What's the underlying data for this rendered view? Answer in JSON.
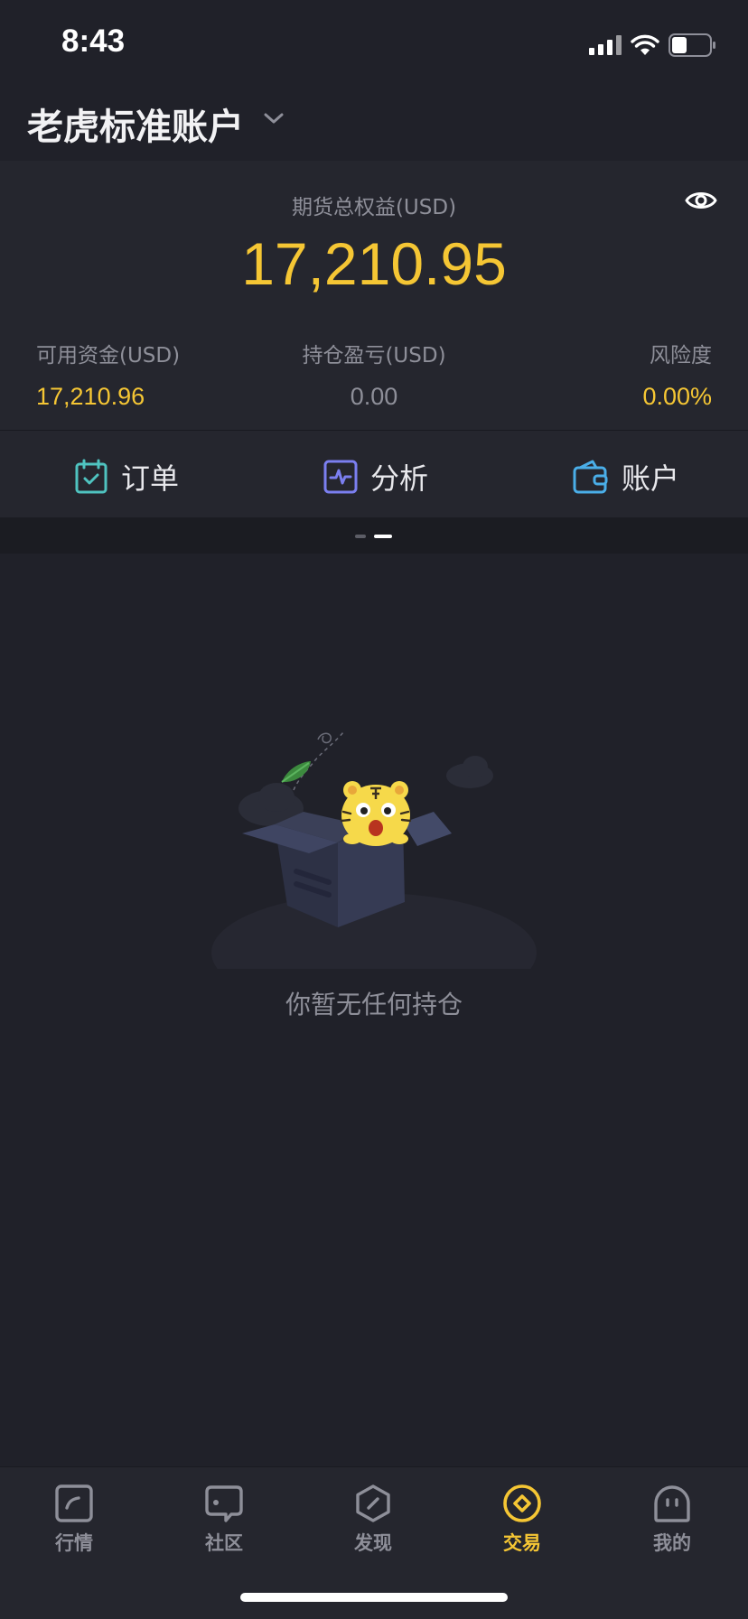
{
  "status_bar": {
    "time": "8:43",
    "battery_level": 0.4
  },
  "header": {
    "account_name": "老虎标准账户"
  },
  "summary": {
    "total_label": "期货总权益(USD)",
    "total_value": "17,210.95",
    "metrics": [
      {
        "label": "可用资金(USD)",
        "value": "17,210.96",
        "color": "#f5c634"
      },
      {
        "label": "持仓盈亏(USD)",
        "value": "0.00",
        "color": "#8e8f99"
      },
      {
        "label": "风险度",
        "value": "0.00%",
        "color": "#f5c634"
      }
    ]
  },
  "actions": [
    {
      "label": "订单",
      "icon": "calendar-check-icon",
      "color": "#4fc3c0"
    },
    {
      "label": "分析",
      "icon": "pulse-chart-icon",
      "color": "#7b7ff0"
    },
    {
      "label": "账户",
      "icon": "wallet-icon",
      "color": "#4aaee8"
    }
  ],
  "pager": {
    "pages": 2,
    "current": 2
  },
  "empty_state": {
    "message": "你暂无任何持仓"
  },
  "tab_bar": {
    "tabs": [
      {
        "label": "行情",
        "icon": "market-icon"
      },
      {
        "label": "社区",
        "icon": "community-icon"
      },
      {
        "label": "发现",
        "icon": "discover-icon"
      },
      {
        "label": "交易",
        "icon": "trade-icon",
        "active": true
      },
      {
        "label": "我的",
        "icon": "profile-icon"
      }
    ]
  },
  "colors": {
    "accent": "#f5c634",
    "background": "#202129",
    "card": "#25262e",
    "muted": "#8e8f99"
  }
}
